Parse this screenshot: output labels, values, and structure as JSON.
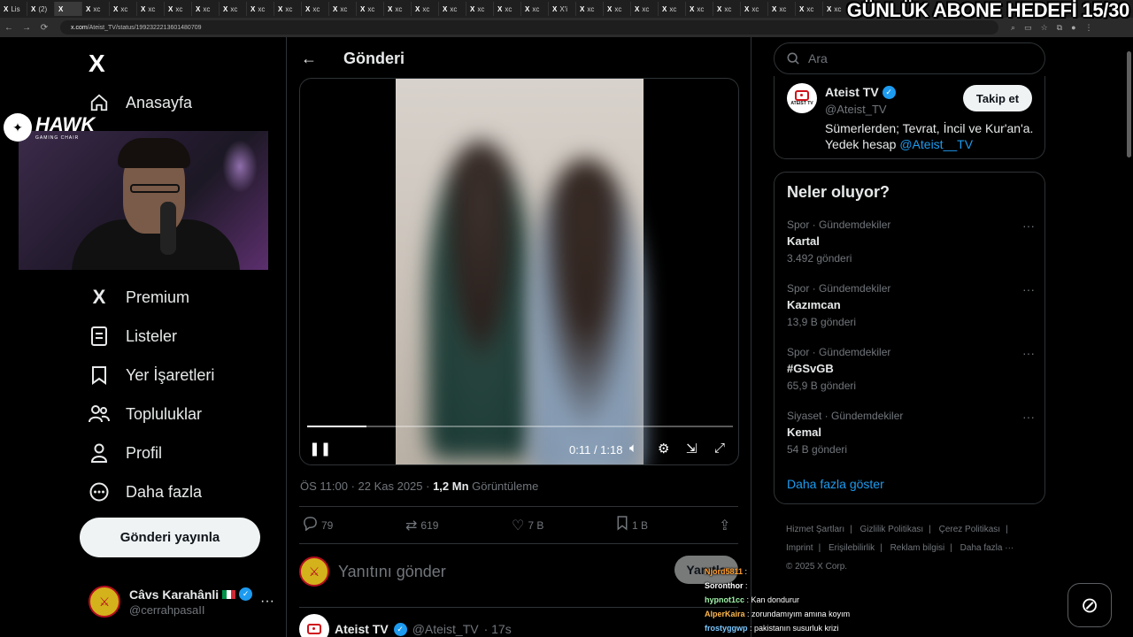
{
  "browser": {
    "tabs": [
      "Lis",
      "(2)",
      "",
      "xc",
      "xc",
      "xc",
      "xc",
      "xc",
      "xc",
      "xc",
      "xc",
      "xc",
      "xc",
      "xc",
      "xc",
      "xc",
      "xc",
      "xc",
      "xc",
      "xc",
      "X'i",
      "xc",
      "xc",
      "xc",
      "xc",
      "xc",
      "xc",
      "xc",
      "xc",
      "xc",
      "xc"
    ],
    "url_domain": "x.com",
    "url_path": "/Ateist_TV/status/1992322213601480709"
  },
  "overlay": {
    "goal_text": "GÜNLÜK ABONE HEDEFİ 15/30",
    "sponsor_name": "HAWK",
    "sponsor_sub": "GAMING CHAIR"
  },
  "nav": {
    "logo": "X",
    "items": [
      {
        "label": "Anasayfa",
        "icon": "home-icon"
      },
      {
        "label": "Premium",
        "icon": "x-icon"
      },
      {
        "label": "Listeler",
        "icon": "list-icon"
      },
      {
        "label": "Yer İşaretleri",
        "icon": "bookmark-icon"
      },
      {
        "label": "Topluluklar",
        "icon": "communities-icon"
      },
      {
        "label": "Profil",
        "icon": "profile-icon"
      },
      {
        "label": "Daha fazla",
        "icon": "more-icon"
      }
    ],
    "post_button": "Gönderi yayınla",
    "account": {
      "name": "Câvs Karahânli",
      "handle": "@cerrahpasaII",
      "more": "···"
    }
  },
  "main": {
    "title": "Gönderi",
    "video": {
      "time": "0:11 / 1:18",
      "progress": 0.14
    },
    "meta_time": "ÖS 11:00 · 22 Kas 2025 · ",
    "meta_views": "1,2 Mn",
    "meta_views_label": " Görüntüleme",
    "actions": {
      "replies": "79",
      "reposts": "619",
      "likes": "7 B",
      "bookmarks": "1 B"
    },
    "reply_placeholder": "Yanıtını gönder",
    "reply_button": "Yanıtla",
    "next_tweet": {
      "name": "Ateist TV",
      "handle": "@Ateist_TV",
      "time": "· 17s"
    }
  },
  "right": {
    "search_placeholder": "Ara",
    "profile": {
      "name": "Ateist TV",
      "handle": "@Ateist_TV",
      "bio_text": "Sümerlerden; Tevrat, İncil ve Kur'an'a.",
      "bio_second": "Yedek hesap ",
      "bio_link": "@Ateist__TV",
      "follow": "Takip et",
      "avatar_label": "ATEIST TV"
    },
    "trends_title": "Neler oluyor?",
    "trends": [
      {
        "category": "Spor · Gündemdekiler",
        "name": "Kartal",
        "count": "3.492 gönderi"
      },
      {
        "category": "Spor · Gündemdekiler",
        "name": "Kazımcan",
        "count": "13,9 B gönderi"
      },
      {
        "category": "Spor · Gündemdekiler",
        "name": "#GSvGB",
        "count": "65,9 B gönderi"
      },
      {
        "category": "Siyaset · Gündemdekiler",
        "name": "Kemal",
        "count": "54 B gönderi"
      }
    ],
    "show_more": "Daha fazla göster",
    "footer": [
      "Hizmet Şartları",
      "Gizlilik Politikası",
      "Çerez Politikası",
      "Imprint",
      "Erişilebilirlik",
      "Reklam bilgisi",
      "Daha fazla ···",
      "© 2025 X Corp."
    ]
  },
  "chat": [
    {
      "user": "Njord5811",
      "msg": " : ",
      "color": "#ff9d2e"
    },
    {
      "user": "Soronthor",
      "msg": " : ",
      "color": "#ffffff"
    },
    {
      "user": "hypnot1cc",
      "msg": " : Kan dondurur",
      "color": "#9ef0a8"
    },
    {
      "user": "AlperKaira",
      "msg": " : zorundamıyım amına koyım",
      "color": "#ffb84d"
    },
    {
      "user": "frostyggwp",
      "msg": " : pakistanın susurluk krizi",
      "color": "#7ac7ff"
    }
  ]
}
